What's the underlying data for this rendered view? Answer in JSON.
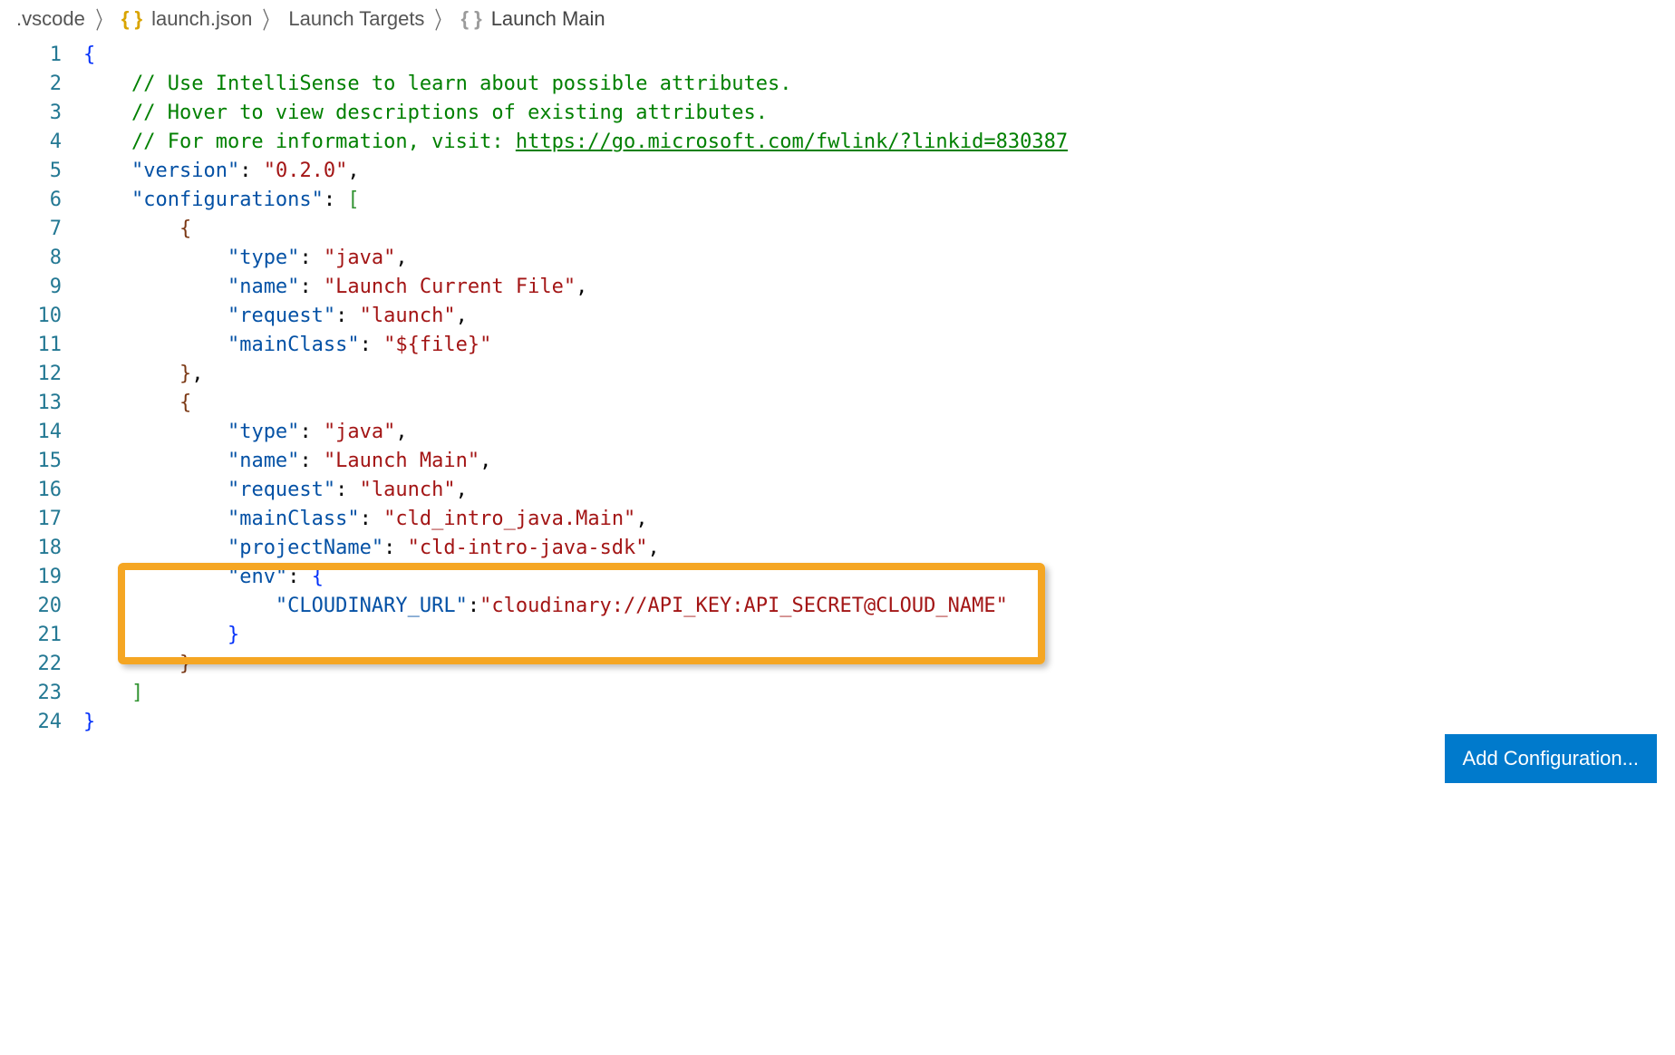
{
  "breadcrumb": {
    "folder": ".vscode",
    "file": "launch.json",
    "section": "Launch Targets",
    "leaf": "Launch Main"
  },
  "lines": {
    "n1": "1",
    "n2": "2",
    "n3": "3",
    "n4": "4",
    "n5": "5",
    "n6": "6",
    "n7": "7",
    "n8": "8",
    "n9": "9",
    "n10": "10",
    "n11": "11",
    "n12": "12",
    "n13": "13",
    "n14": "14",
    "n15": "15",
    "n16": "16",
    "n17": "17",
    "n18": "18",
    "n19": "19",
    "n20": "20",
    "n21": "21",
    "n22": "22",
    "n23": "23",
    "n24": "24"
  },
  "code": {
    "c2": "// Use IntelliSense to learn about possible attributes.",
    "c3": "// Hover to view descriptions of existing attributes.",
    "c4a": "// For more information, visit: ",
    "c4b": "https://go.microsoft.com/fwlink/?linkid=830387",
    "k_version": "\"version\"",
    "v_version": "\"0.2.0\"",
    "k_configs": "\"configurations\"",
    "k_type": "\"type\"",
    "v_java": "\"java\"",
    "k_name": "\"name\"",
    "v_launch_current": "\"Launch Current File\"",
    "k_request": "\"request\"",
    "v_launch": "\"launch\"",
    "k_mainclass": "\"mainClass\"",
    "v_file": "\"${file}\"",
    "v_launch_main": "\"Launch Main\"",
    "v_mainclass2": "\"cld_intro_java.Main\"",
    "k_projectname": "\"projectName\"",
    "v_projectname": "\"cld-intro-java-sdk\"",
    "k_env": "\"env\"",
    "k_cloudinary": "\"CLOUDINARY_URL\"",
    "v_cloudinary": "\"cloudinary://API_KEY:API_SECRET@CLOUD_NAME\""
  },
  "button": {
    "add_config": "Add Configuration..."
  },
  "icons": {
    "json_braces": "{ }",
    "obj_braces": "{ }"
  }
}
